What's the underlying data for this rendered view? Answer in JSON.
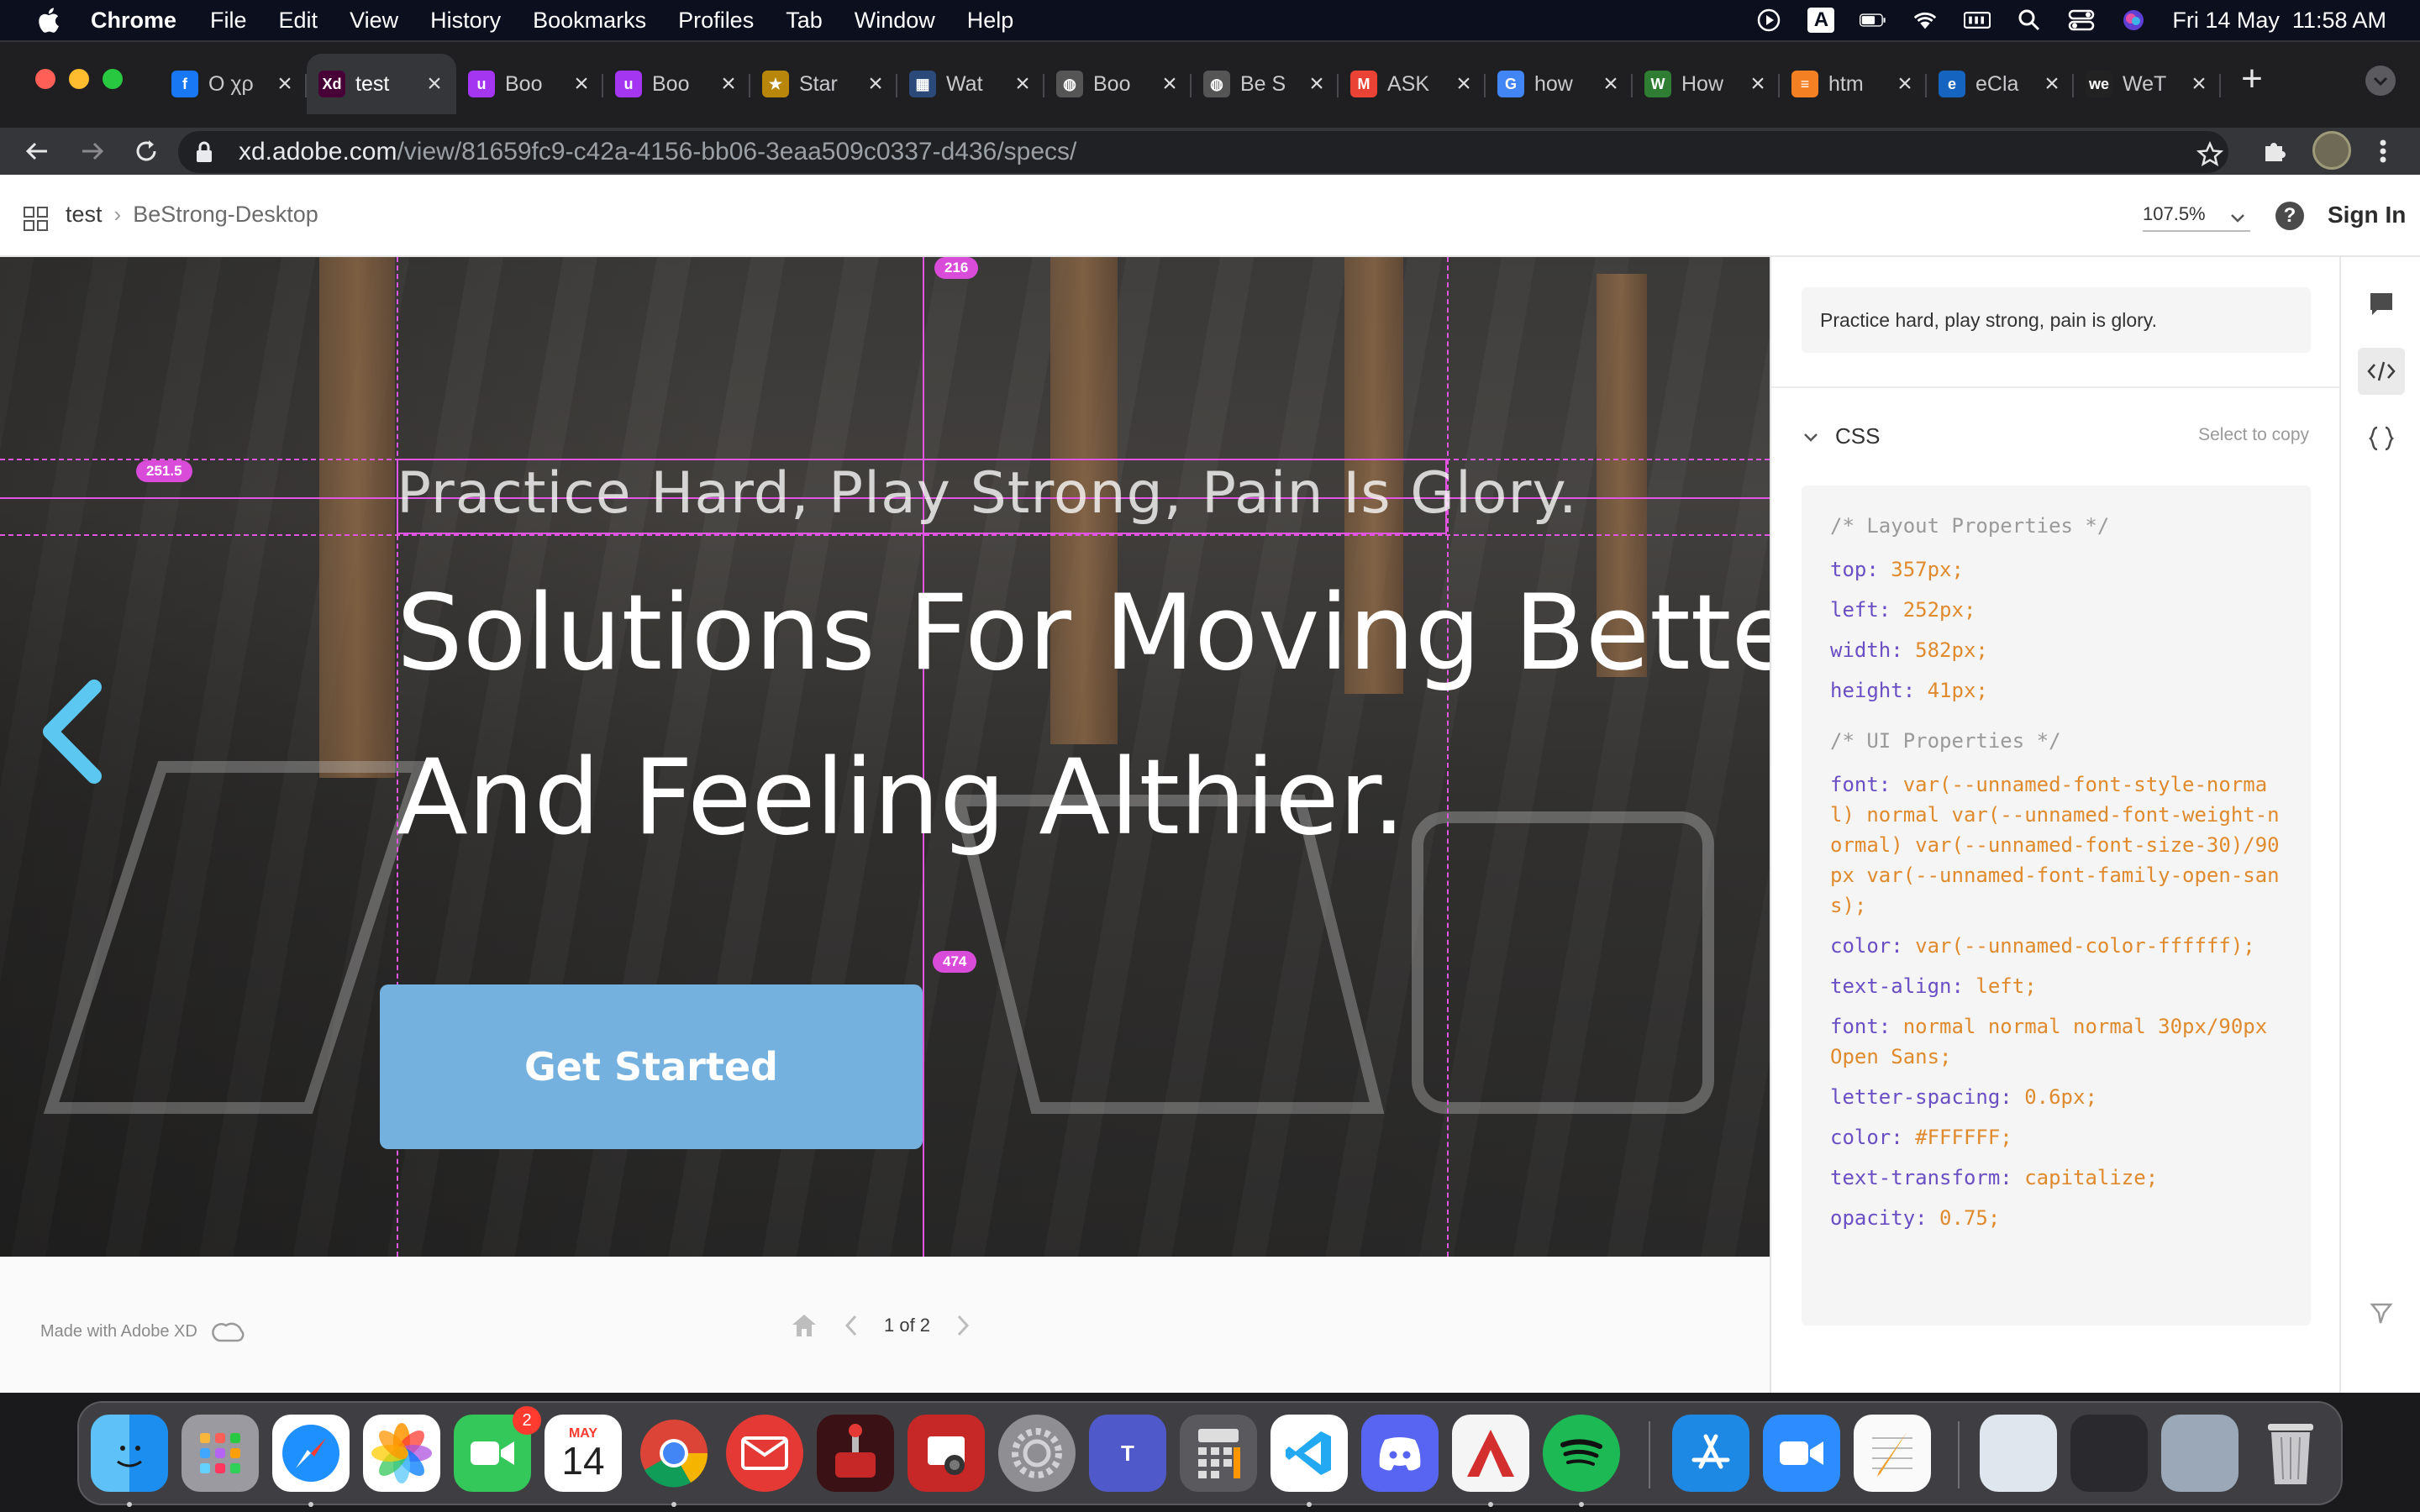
{
  "menubar": {
    "app_name": "Chrome",
    "items": [
      "File",
      "Edit",
      "View",
      "History",
      "Bookmarks",
      "Profiles",
      "Tab",
      "Window",
      "Help"
    ],
    "clock": "Fri 14 May  11:58 AM",
    "input_source": "A"
  },
  "browser": {
    "tabs": [
      {
        "label": "O χρ",
        "icon": "facebook-icon",
        "color": "#1877f2",
        "glyph": "f"
      },
      {
        "label": "test",
        "icon": "adobe-xd-icon",
        "color": "#470137",
        "glyph": "Xd",
        "active": true
      },
      {
        "label": "Boo",
        "icon": "udemy-icon",
        "color": "#a435f0",
        "glyph": "u"
      },
      {
        "label": "Boo",
        "icon": "udemy-icon",
        "color": "#a435f0",
        "glyph": "u"
      },
      {
        "label": "Star",
        "icon": "star-site-icon",
        "color": "#b8860b",
        "glyph": "★"
      },
      {
        "label": "Wat",
        "icon": "video-site-icon",
        "color": "#2b4a7a",
        "glyph": "▦"
      },
      {
        "label": "Boo",
        "icon": "globe-icon",
        "color": "#555",
        "glyph": "◍"
      },
      {
        "label": "Be S",
        "icon": "globe-icon",
        "color": "#555",
        "glyph": "◍"
      },
      {
        "label": "ASK",
        "icon": "gmail-icon",
        "color": "#ea4335",
        "glyph": "M"
      },
      {
        "label": "how",
        "icon": "google-icon",
        "color": "#4285f4",
        "glyph": "G"
      },
      {
        "label": "How",
        "icon": "w-site-icon",
        "color": "#2e7d32",
        "glyph": "W"
      },
      {
        "label": "htm",
        "icon": "stackoverflow-icon",
        "color": "#f48024",
        "glyph": "≡"
      },
      {
        "label": "eCla",
        "icon": "eclass-icon",
        "color": "#1565c0",
        "glyph": "e"
      },
      {
        "label": "WeT",
        "icon": "wetransfer-icon",
        "color": "#222",
        "glyph": "we"
      }
    ],
    "url_host": "xd.adobe.com",
    "url_path": "/view/81659fc9-c42a-4156-bb06-3eaa509c0337-d436/specs/"
  },
  "xd": {
    "project": "test",
    "artboard": "BeStrong-Desktop",
    "zoom": "107.5%",
    "sign_in": "Sign In",
    "canvas": {
      "subtitle": "Practice Hard, Play Strong, Pain Is Glory.",
      "headline_line1": "Solutions For Moving Better",
      "headline_line2": "And Feeling Althier.",
      "cta": "Get Started",
      "measure_top": "216",
      "measure_left": "251.5",
      "measure_bottom": "474"
    },
    "footer": {
      "made_with": "Made with Adobe XD",
      "pager": "1 of 2"
    },
    "panel": {
      "sample_text": "Practice hard, play strong, pain is glory.",
      "css_title": "CSS",
      "copy_hint": "Select to copy",
      "layout_comment": "/* Layout Properties */",
      "layout": [
        {
          "prop": "top:",
          "val": "357px;"
        },
        {
          "prop": "left:",
          "val": "252px;"
        },
        {
          "prop": "width:",
          "val": "582px;"
        },
        {
          "prop": "height:",
          "val": "41px;"
        }
      ],
      "ui_comment": "/* UI Properties */",
      "ui": [
        {
          "prop": "font:",
          "val": "var(--unnamed-font-style-normal) normal var(--unnamed-font-weight-normal) var(--unnamed-font-size-30)/90px var(--unnamed-font-family-open-sans);"
        },
        {
          "prop": "color:",
          "val": "var(--unnamed-color-ffffff);"
        },
        {
          "prop": "text-align:",
          "val": "left;"
        },
        {
          "prop": "font:",
          "val": "normal normal normal 30px/90px Open Sans;"
        },
        {
          "prop": "letter-spacing:",
          "val": "0.6px;"
        },
        {
          "prop": "color:",
          "val": "#FFFFFF;"
        },
        {
          "prop": "text-transform:",
          "val": "capitalize;"
        },
        {
          "prop": "opacity:",
          "val": "0.75;"
        }
      ]
    }
  },
  "dock": {
    "calendar_month": "MAY",
    "calendar_day": "14",
    "facetime_badge": "2"
  }
}
